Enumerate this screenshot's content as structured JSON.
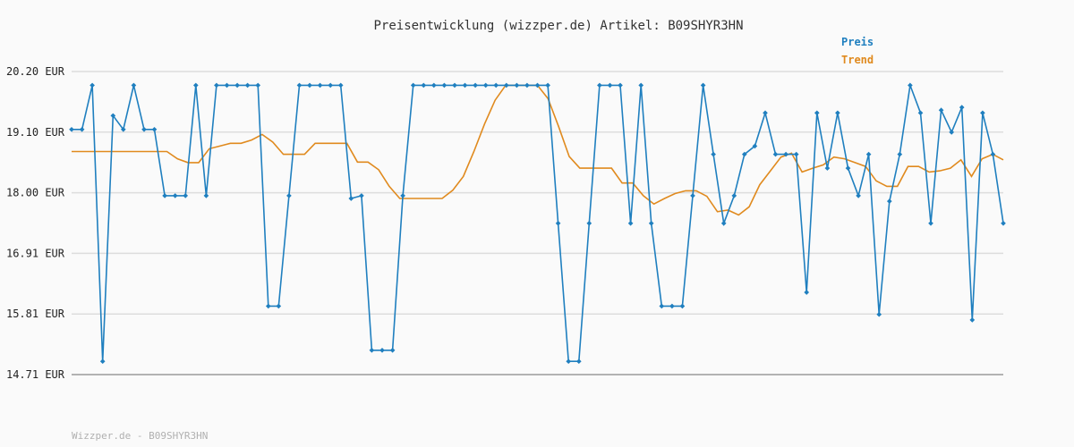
{
  "chart_data": {
    "type": "line",
    "title": "Preisentwicklung (wizzper.de) Artikel: B09SHYR3HN",
    "footer": "Wizzper.de - B09SHYR3HN",
    "y_tick_labels": [
      "14.71 EUR",
      "15.81 EUR",
      "16.91 EUR",
      "18.00 EUR",
      "19.10 EUR",
      "20.20 EUR"
    ],
    "ylim": [
      14.71,
      20.2
    ],
    "grid": true,
    "legend_position": "top-right",
    "colors": {
      "Preis": "#1f7fbf",
      "Trend": "#e08a1e"
    },
    "series": [
      {
        "name": "Preis",
        "values": [
          19.15,
          19.15,
          19.95,
          14.95,
          19.4,
          19.15,
          19.95,
          19.15,
          19.15,
          17.95,
          17.95,
          17.95,
          19.95,
          17.95,
          19.95,
          19.95,
          19.95,
          19.95,
          19.95,
          15.95,
          15.95,
          17.95,
          19.95,
          19.95,
          19.95,
          19.95,
          19.95,
          17.9,
          17.95,
          15.15,
          15.15,
          15.15,
          17.95,
          19.95,
          19.95,
          19.95,
          19.95,
          19.95,
          19.95,
          19.95,
          19.95,
          19.95,
          19.95,
          19.95,
          19.95,
          19.95,
          19.95,
          17.45,
          14.95,
          14.95,
          17.45,
          19.95,
          19.95,
          19.95,
          17.45,
          19.95,
          17.45,
          15.95,
          15.95,
          15.95,
          17.95,
          19.95,
          18.7,
          17.45,
          17.95,
          18.7,
          18.85,
          19.45,
          18.7,
          18.7,
          18.7,
          16.2,
          19.45,
          18.45,
          19.45,
          18.45,
          17.95,
          18.7,
          15.8,
          17.85,
          18.7,
          19.95,
          19.45,
          17.45,
          19.5,
          19.1,
          19.55,
          15.7,
          19.45,
          18.7,
          17.45
        ],
        "x_offsets": [
          0,
          0.51,
          0.5,
          0.5
        ]
      },
      {
        "name": "Trend",
        "values": [
          18.75,
          18.75,
          18.75,
          18.75,
          18.75,
          18.75,
          18.75,
          18.75,
          18.75,
          18.75,
          18.62,
          18.55,
          18.55,
          18.8,
          18.85,
          18.9,
          18.9,
          18.96,
          19.06,
          18.92,
          18.7,
          18.7,
          18.7,
          18.9,
          18.9,
          18.9,
          18.9,
          18.56,
          18.56,
          18.42,
          18.12,
          17.9,
          17.9,
          17.9,
          17.9,
          17.9,
          18.05,
          18.3,
          18.75,
          19.25,
          19.68,
          19.95,
          19.95,
          19.95,
          19.95,
          19.71,
          19.2,
          18.66,
          18.45,
          18.45,
          18.45,
          18.45,
          18.18,
          18.18,
          17.95,
          17.8,
          17.9,
          17.99,
          18.04,
          18.04,
          17.94,
          17.66,
          17.69,
          17.6,
          17.75,
          18.15,
          18.4,
          18.65,
          18.72,
          18.38,
          18.45,
          18.51,
          18.65,
          18.62,
          18.55,
          18.48,
          18.22,
          18.12,
          18.12,
          18.48,
          18.48,
          18.38,
          18.4,
          18.45,
          18.6,
          18.3,
          18.62,
          18.7,
          18.6
        ]
      }
    ]
  }
}
